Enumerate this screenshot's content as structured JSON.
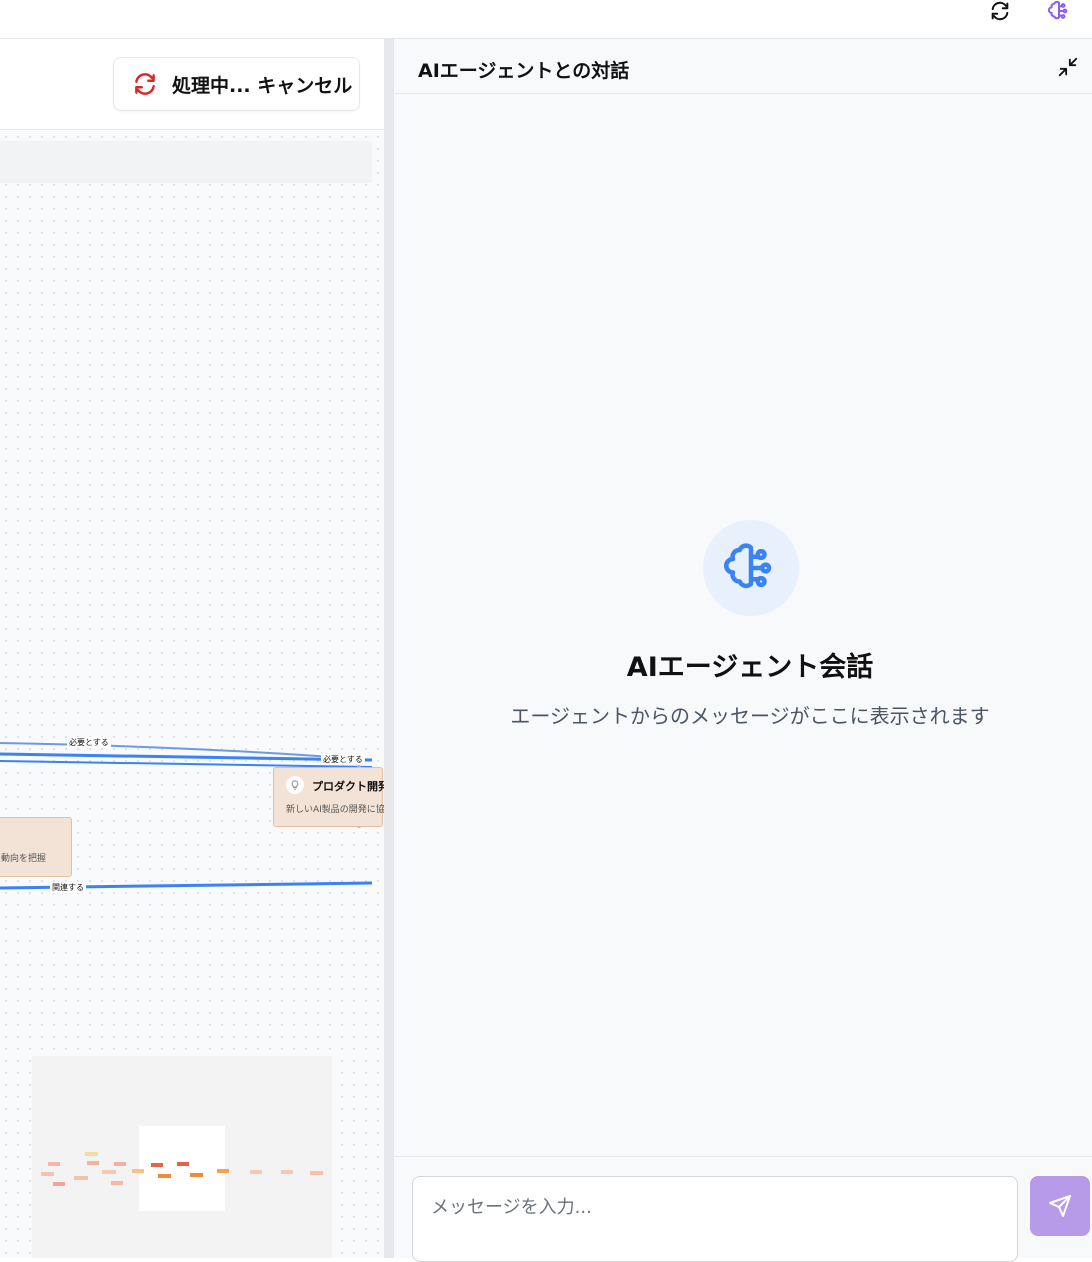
{
  "topbar": {
    "refresh_icon": "refresh-icon",
    "agent_icon": "brain-circuit-icon",
    "agent_icon_color": "#8b5cf6"
  },
  "canvas_header": {
    "cancel_label": "処理中... キャンセル",
    "cancel_icon_color": "#dc2626"
  },
  "canvas": {
    "edge_labels": {
      "top": "必要とする",
      "right": "必要とする",
      "bottom": "関連する"
    },
    "nodes": {
      "product": {
        "title": "プロダクト開発",
        "desc": "新しいAI製品の開発に協",
        "icon": "lightbulb-icon"
      },
      "left": {
        "desc": "動向を把握"
      }
    },
    "edge_color": "#3b82f6"
  },
  "chat": {
    "title": "AIエージェントとの対話",
    "empty_title": "AIエージェント会話",
    "empty_subtitle": "エージェントからのメッセージがここに表示されます",
    "empty_icon": "brain-circuit-icon",
    "empty_icon_color": "#3b82f6",
    "input_placeholder": "メッセージを入力...",
    "send_icon": "send-icon",
    "send_color": "#b79ae8"
  }
}
